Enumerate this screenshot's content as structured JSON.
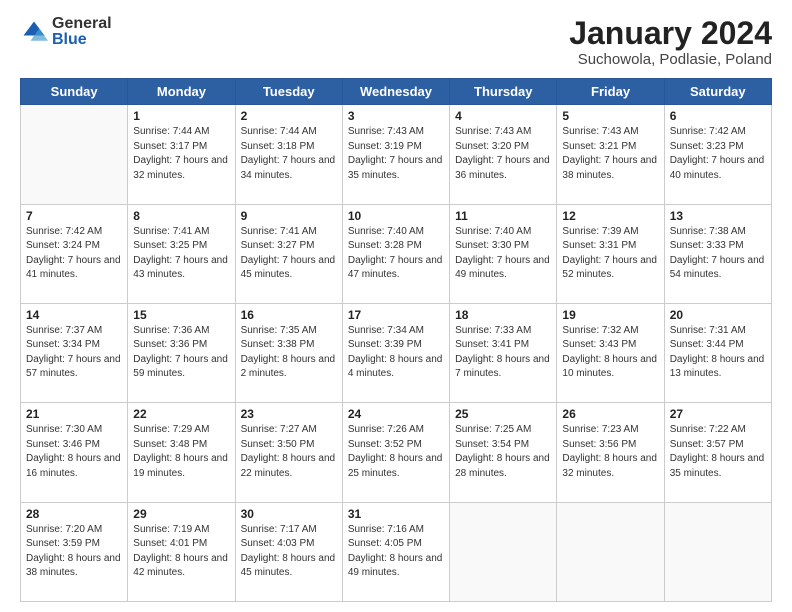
{
  "header": {
    "logo": {
      "general": "General",
      "blue": "Blue"
    },
    "title": "January 2024",
    "location": "Suchowola, Podlasie, Poland"
  },
  "weekdays": [
    "Sunday",
    "Monday",
    "Tuesday",
    "Wednesday",
    "Thursday",
    "Friday",
    "Saturday"
  ],
  "weeks": [
    [
      {
        "day": "",
        "sunrise": "",
        "sunset": "",
        "daylight": ""
      },
      {
        "day": "1",
        "sunrise": "Sunrise: 7:44 AM",
        "sunset": "Sunset: 3:17 PM",
        "daylight": "Daylight: 7 hours and 32 minutes."
      },
      {
        "day": "2",
        "sunrise": "Sunrise: 7:44 AM",
        "sunset": "Sunset: 3:18 PM",
        "daylight": "Daylight: 7 hours and 34 minutes."
      },
      {
        "day": "3",
        "sunrise": "Sunrise: 7:43 AM",
        "sunset": "Sunset: 3:19 PM",
        "daylight": "Daylight: 7 hours and 35 minutes."
      },
      {
        "day": "4",
        "sunrise": "Sunrise: 7:43 AM",
        "sunset": "Sunset: 3:20 PM",
        "daylight": "Daylight: 7 hours and 36 minutes."
      },
      {
        "day": "5",
        "sunrise": "Sunrise: 7:43 AM",
        "sunset": "Sunset: 3:21 PM",
        "daylight": "Daylight: 7 hours and 38 minutes."
      },
      {
        "day": "6",
        "sunrise": "Sunrise: 7:42 AM",
        "sunset": "Sunset: 3:23 PM",
        "daylight": "Daylight: 7 hours and 40 minutes."
      }
    ],
    [
      {
        "day": "7",
        "sunrise": "Sunrise: 7:42 AM",
        "sunset": "Sunset: 3:24 PM",
        "daylight": "Daylight: 7 hours and 41 minutes."
      },
      {
        "day": "8",
        "sunrise": "Sunrise: 7:41 AM",
        "sunset": "Sunset: 3:25 PM",
        "daylight": "Daylight: 7 hours and 43 minutes."
      },
      {
        "day": "9",
        "sunrise": "Sunrise: 7:41 AM",
        "sunset": "Sunset: 3:27 PM",
        "daylight": "Daylight: 7 hours and 45 minutes."
      },
      {
        "day": "10",
        "sunrise": "Sunrise: 7:40 AM",
        "sunset": "Sunset: 3:28 PM",
        "daylight": "Daylight: 7 hours and 47 minutes."
      },
      {
        "day": "11",
        "sunrise": "Sunrise: 7:40 AM",
        "sunset": "Sunset: 3:30 PM",
        "daylight": "Daylight: 7 hours and 49 minutes."
      },
      {
        "day": "12",
        "sunrise": "Sunrise: 7:39 AM",
        "sunset": "Sunset: 3:31 PM",
        "daylight": "Daylight: 7 hours and 52 minutes."
      },
      {
        "day": "13",
        "sunrise": "Sunrise: 7:38 AM",
        "sunset": "Sunset: 3:33 PM",
        "daylight": "Daylight: 7 hours and 54 minutes."
      }
    ],
    [
      {
        "day": "14",
        "sunrise": "Sunrise: 7:37 AM",
        "sunset": "Sunset: 3:34 PM",
        "daylight": "Daylight: 7 hours and 57 minutes."
      },
      {
        "day": "15",
        "sunrise": "Sunrise: 7:36 AM",
        "sunset": "Sunset: 3:36 PM",
        "daylight": "Daylight: 7 hours and 59 minutes."
      },
      {
        "day": "16",
        "sunrise": "Sunrise: 7:35 AM",
        "sunset": "Sunset: 3:38 PM",
        "daylight": "Daylight: 8 hours and 2 minutes."
      },
      {
        "day": "17",
        "sunrise": "Sunrise: 7:34 AM",
        "sunset": "Sunset: 3:39 PM",
        "daylight": "Daylight: 8 hours and 4 minutes."
      },
      {
        "day": "18",
        "sunrise": "Sunrise: 7:33 AM",
        "sunset": "Sunset: 3:41 PM",
        "daylight": "Daylight: 8 hours and 7 minutes."
      },
      {
        "day": "19",
        "sunrise": "Sunrise: 7:32 AM",
        "sunset": "Sunset: 3:43 PM",
        "daylight": "Daylight: 8 hours and 10 minutes."
      },
      {
        "day": "20",
        "sunrise": "Sunrise: 7:31 AM",
        "sunset": "Sunset: 3:44 PM",
        "daylight": "Daylight: 8 hours and 13 minutes."
      }
    ],
    [
      {
        "day": "21",
        "sunrise": "Sunrise: 7:30 AM",
        "sunset": "Sunset: 3:46 PM",
        "daylight": "Daylight: 8 hours and 16 minutes."
      },
      {
        "day": "22",
        "sunrise": "Sunrise: 7:29 AM",
        "sunset": "Sunset: 3:48 PM",
        "daylight": "Daylight: 8 hours and 19 minutes."
      },
      {
        "day": "23",
        "sunrise": "Sunrise: 7:27 AM",
        "sunset": "Sunset: 3:50 PM",
        "daylight": "Daylight: 8 hours and 22 minutes."
      },
      {
        "day": "24",
        "sunrise": "Sunrise: 7:26 AM",
        "sunset": "Sunset: 3:52 PM",
        "daylight": "Daylight: 8 hours and 25 minutes."
      },
      {
        "day": "25",
        "sunrise": "Sunrise: 7:25 AM",
        "sunset": "Sunset: 3:54 PM",
        "daylight": "Daylight: 8 hours and 28 minutes."
      },
      {
        "day": "26",
        "sunrise": "Sunrise: 7:23 AM",
        "sunset": "Sunset: 3:56 PM",
        "daylight": "Daylight: 8 hours and 32 minutes."
      },
      {
        "day": "27",
        "sunrise": "Sunrise: 7:22 AM",
        "sunset": "Sunset: 3:57 PM",
        "daylight": "Daylight: 8 hours and 35 minutes."
      }
    ],
    [
      {
        "day": "28",
        "sunrise": "Sunrise: 7:20 AM",
        "sunset": "Sunset: 3:59 PM",
        "daylight": "Daylight: 8 hours and 38 minutes."
      },
      {
        "day": "29",
        "sunrise": "Sunrise: 7:19 AM",
        "sunset": "Sunset: 4:01 PM",
        "daylight": "Daylight: 8 hours and 42 minutes."
      },
      {
        "day": "30",
        "sunrise": "Sunrise: 7:17 AM",
        "sunset": "Sunset: 4:03 PM",
        "daylight": "Daylight: 8 hours and 45 minutes."
      },
      {
        "day": "31",
        "sunrise": "Sunrise: 7:16 AM",
        "sunset": "Sunset: 4:05 PM",
        "daylight": "Daylight: 8 hours and 49 minutes."
      },
      {
        "day": "",
        "sunrise": "",
        "sunset": "",
        "daylight": ""
      },
      {
        "day": "",
        "sunrise": "",
        "sunset": "",
        "daylight": ""
      },
      {
        "day": "",
        "sunrise": "",
        "sunset": "",
        "daylight": ""
      }
    ]
  ]
}
